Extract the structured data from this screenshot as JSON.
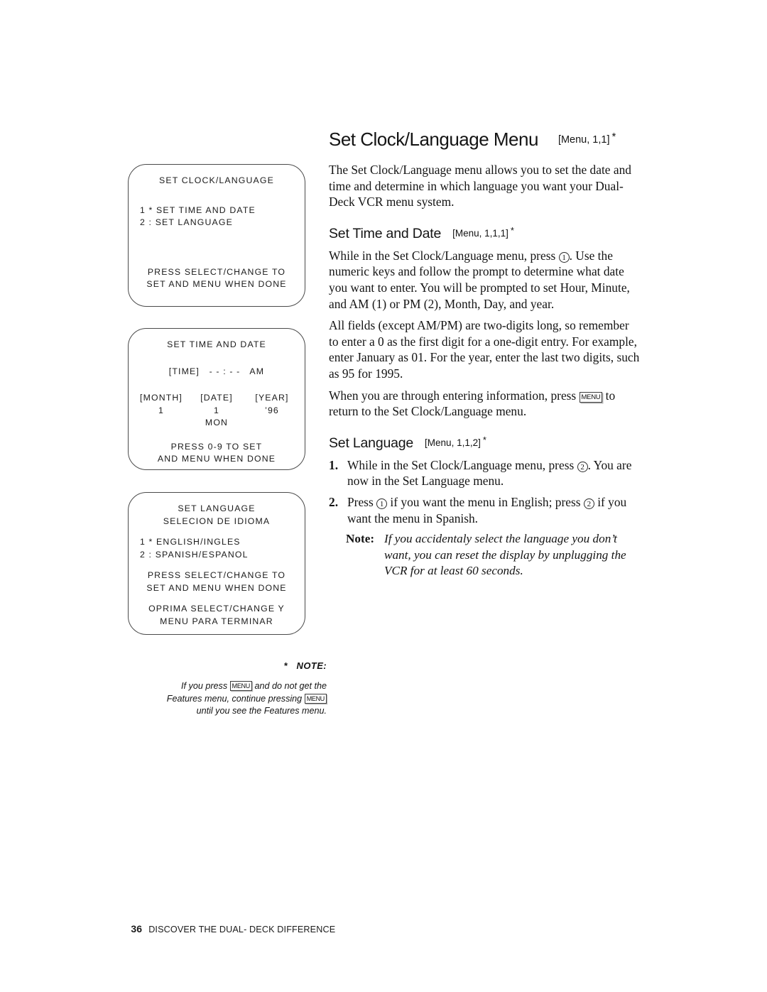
{
  "page": {
    "footer_page_number": "36",
    "footer_title": "DISCOVER THE DUAL- DECK DIFFERENCE"
  },
  "heading": {
    "title": "Set Clock/Language Menu",
    "menu_code": "[Menu, 1,1]",
    "asterisk": "*"
  },
  "intro": "The Set Clock/Language menu allows you to set the date and time and determine in which language you want your Dual-Deck VCR menu system.",
  "sections": [
    {
      "title": "Set Time and Date",
      "menu_code": "[Menu, 1,1,1]",
      "asterisk": "*",
      "paragraphs": [
        {
          "part_a": "While in the Set Clock/Language menu, press ",
          "key": "1",
          "part_b": ". Use the numeric keys and follow the prompt to determine what date you want to enter. You will be prompted to set Hour, Minute, and AM (1) or PM (2), Month, Day, and year."
        },
        {
          "text": "All fields (except AM/PM) are two-digits long, so remember to enter a 0 as the first digit for a one-digit entry. For example, enter January as 01. For the year, enter the last two digits, such as 95 for 1995."
        },
        {
          "part_a": "When you are through entering information, press ",
          "keycap": "MENU",
          "part_b": " to return to the Set Clock/Language menu."
        }
      ]
    },
    {
      "title": "Set Language",
      "menu_code": "[Menu, 1,1,2]",
      "asterisk": "*",
      "steps": [
        {
          "num": "1.",
          "part_a": "While in the Set Clock/Language menu, press ",
          "key": "2",
          "part_b": ". You are now in the Set Language menu."
        },
        {
          "num": "2.",
          "part_a": "Press ",
          "key": "1",
          "part_b": " if you want the menu in English; press ",
          "key2": "2",
          "part_c": " if you want the menu in Spanish."
        }
      ],
      "note": {
        "label": "Note:",
        "text": "If you accidentaly select the language you don’t want, you can reset the display by unplugging the VCR for at least 60 seconds."
      }
    }
  ],
  "screens": [
    {
      "name": "set-clock-language",
      "title": "SET CLOCK/LANGUAGE",
      "option_1": "1 * SET TIME AND DATE",
      "option_2": "2 : SET LANGUAGE",
      "prompt_1": "PRESS SELECT/CHANGE TO",
      "prompt_2": "SET AND MENU WHEN DONE"
    },
    {
      "name": "set-time-and-date",
      "title": "SET TIME AND DATE",
      "time_row": "[TIME]   - - : - -   AM",
      "label_month": "[MONTH]",
      "label_date": "[DATE]",
      "label_year": "[YEAR]",
      "value_month": "1",
      "sep_1": "/",
      "value_date": "1",
      "sep_2": "/",
      "value_year": "’96",
      "weekday": "MON",
      "prompt_1": "PRESS 0-9 TO SET",
      "prompt_2": "AND MENU WHEN DONE"
    },
    {
      "name": "set-language",
      "title_en": "SET LANGUAGE",
      "title_es": "SELECION DE IDIOMA",
      "option_1": "1 * ENGLISH/INGLES",
      "option_2": "2 : SPANISH/ESPANOL",
      "prompt_en_1": "PRESS SELECT/CHANGE TO",
      "prompt_en_2": "SET AND MENU WHEN DONE",
      "prompt_es_1": "OPRIMA SELECT/CHANGE Y",
      "prompt_es_2": "MENU PARA TERMINAR"
    }
  ],
  "footnote": {
    "star": "*",
    "label": "NOTE:",
    "line1_a": "If you press ",
    "line1_key": "MENU",
    "line1_b": " and do not get the",
    "line2_a": "Features menu, continue pressing ",
    "line2_key": "MENU",
    "line3": "until you see the Features menu."
  }
}
